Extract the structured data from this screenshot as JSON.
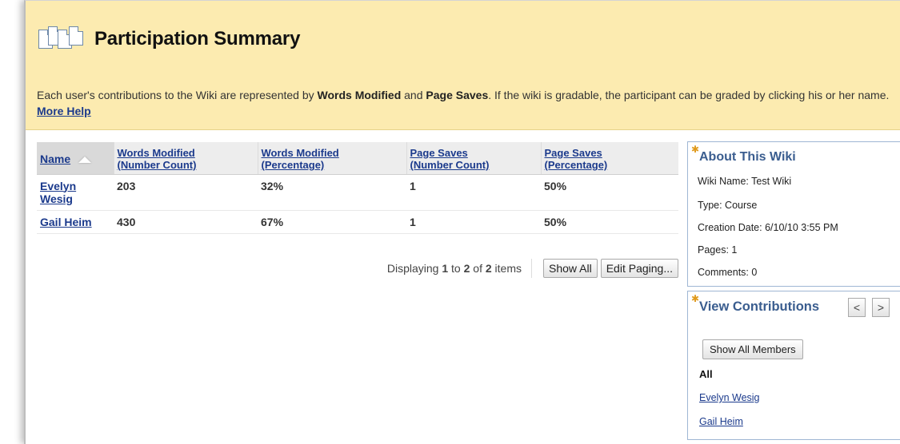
{
  "header": {
    "title": "Participation Summary",
    "desc_part1": "Each user's contributions to the Wiki are represented by ",
    "desc_bold1": "Words Modified",
    "desc_part2": " and ",
    "desc_bold2": "Page Saves",
    "desc_part3": ". If the wiki is gradable, the participant can be graded by clicking his or her name. ",
    "more_help": "More Help"
  },
  "table": {
    "columns": [
      {
        "line1": "Name",
        "line2": ""
      },
      {
        "line1": "Words Modified",
        "line2": "(Number Count)"
      },
      {
        "line1": "Words Modified",
        "line2": "(Percentage)"
      },
      {
        "line1": "Page Saves",
        "line2": "(Number Count)"
      },
      {
        "line1": "Page Saves",
        "line2": "(Percentage)"
      }
    ],
    "rows": [
      {
        "name_line1": "Evelyn",
        "name_line2": "Wesig",
        "words_count": "203",
        "words_pct": "32%",
        "saves_count": "1",
        "saves_pct": "50%"
      },
      {
        "name_line1": "Gail Heim",
        "name_line2": "",
        "words_count": "430",
        "words_pct": "67%",
        "saves_count": "1",
        "saves_pct": "50%"
      }
    ]
  },
  "paging": {
    "displaying_prefix": "Displaying ",
    "from": "1",
    "to_text": " to ",
    "to": "2",
    "of_text": " of ",
    "total": "2",
    "items_text": " items",
    "show_all": "Show All",
    "edit_paging": "Edit Paging..."
  },
  "about": {
    "title": "About This Wiki",
    "wiki_name": "Wiki Name: Test Wiki",
    "type": "Type: Course",
    "creation_date": "Creation Date: 6/10/10 3:55 PM",
    "pages": "Pages: 1",
    "comments": "Comments: 0"
  },
  "contributions": {
    "title": "View Contributions",
    "prev": "<",
    "next": ">",
    "show_all_members": "Show All Members",
    "all_label": "All",
    "members": [
      "Evelyn Wesig",
      "Gail Heim"
    ]
  },
  "colors": {
    "header_bg": "#fcebb0",
    "link": "#1b3a8c",
    "panel_title": "#3a5d8f",
    "star": "#e09a1c"
  }
}
